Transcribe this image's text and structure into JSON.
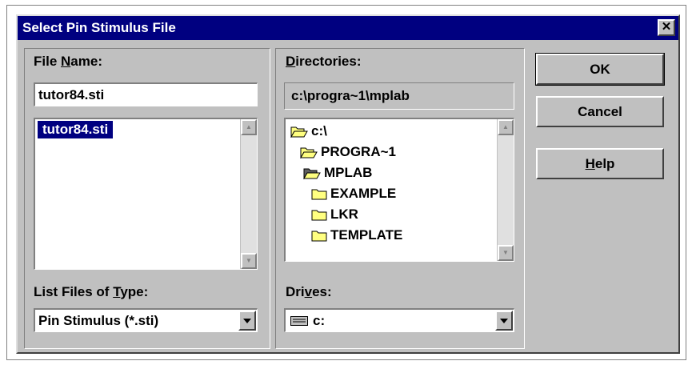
{
  "window": {
    "title": "Select Pin Stimulus File",
    "close_glyph": "✕"
  },
  "file_name": {
    "label_before": "File ",
    "label_mnemonic": "N",
    "label_after": "ame:",
    "value": "tutor84.sti",
    "list": [
      {
        "name": "tutor84.sti",
        "selected": true
      }
    ]
  },
  "file_type": {
    "label_before": "List Files of ",
    "label_mnemonic": "T",
    "label_after": "ype:",
    "selected": "Pin Stimulus (*.sti)"
  },
  "directories": {
    "label_before": "",
    "label_mnemonic": "D",
    "label_after": "irectories:",
    "current_path": "c:\\progra~1\\mplab",
    "tree": [
      {
        "name": "c:\\",
        "icon": "folder-open-icon"
      },
      {
        "name": "PROGRA~1",
        "icon": "folder-open-icon"
      },
      {
        "name": "MPLAB",
        "icon": "folder-open-dark-icon"
      },
      {
        "name": "EXAMPLE",
        "icon": "folder-closed-icon"
      },
      {
        "name": "LKR",
        "icon": "folder-closed-icon"
      },
      {
        "name": "TEMPLATE",
        "icon": "folder-closed-icon"
      }
    ]
  },
  "drives": {
    "label_before": "Dri",
    "label_mnemonic": "v",
    "label_after": "es:",
    "selected": "c:",
    "icon": "drive-icon"
  },
  "buttons": {
    "ok": "OK",
    "cancel": "Cancel",
    "help_mnemonic": "H",
    "help_rest": "elp"
  },
  "colors": {
    "titlebar": "#000080",
    "face": "#c0c0c0",
    "folder": "#ffff80"
  }
}
